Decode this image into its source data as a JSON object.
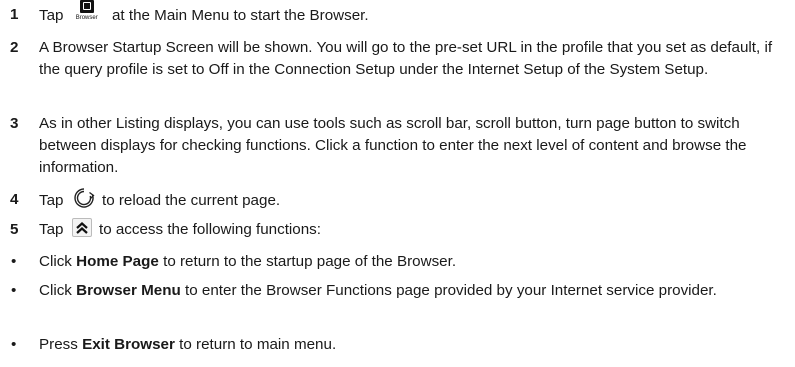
{
  "steps": [
    {
      "number": "1",
      "before": "Tap",
      "after": "at the Main Menu to start the Browser.",
      "icon": "browser-icon",
      "icon_caption": "Browser"
    },
    {
      "number": "2",
      "text": "A Browser Startup Screen will be shown. You will go to the pre-set URL in the profile that you set as default, if the query profile is set to Off in the Connection Setup under the Internet Setup of the System Setup."
    },
    {
      "number": "3",
      "text": "As in other Listing displays, you can use tools such as scroll bar, scroll button, turn page button to switch between displays for checking functions. Click a function to enter the next level of content and browse the information."
    },
    {
      "number": "4",
      "before": "Tap",
      "after": "to reload the current page.",
      "icon": "reload-icon"
    },
    {
      "number": "5",
      "before": "Tap",
      "after": "to access the following functions:",
      "icon": "double-chevron-up-icon"
    }
  ],
  "bullets": [
    {
      "marker": "•",
      "before": "Click",
      "bold": "Home Page",
      "after": "to return to the startup page of the Browser."
    },
    {
      "marker": "•",
      "before": "Click",
      "bold": "Browser Menu",
      "after": "to enter the Browser Functions page provided by your Internet service provider."
    },
    {
      "marker": "•",
      "before": "Press",
      "bold": "Exit Browser",
      "after": "to return to main menu."
    }
  ]
}
